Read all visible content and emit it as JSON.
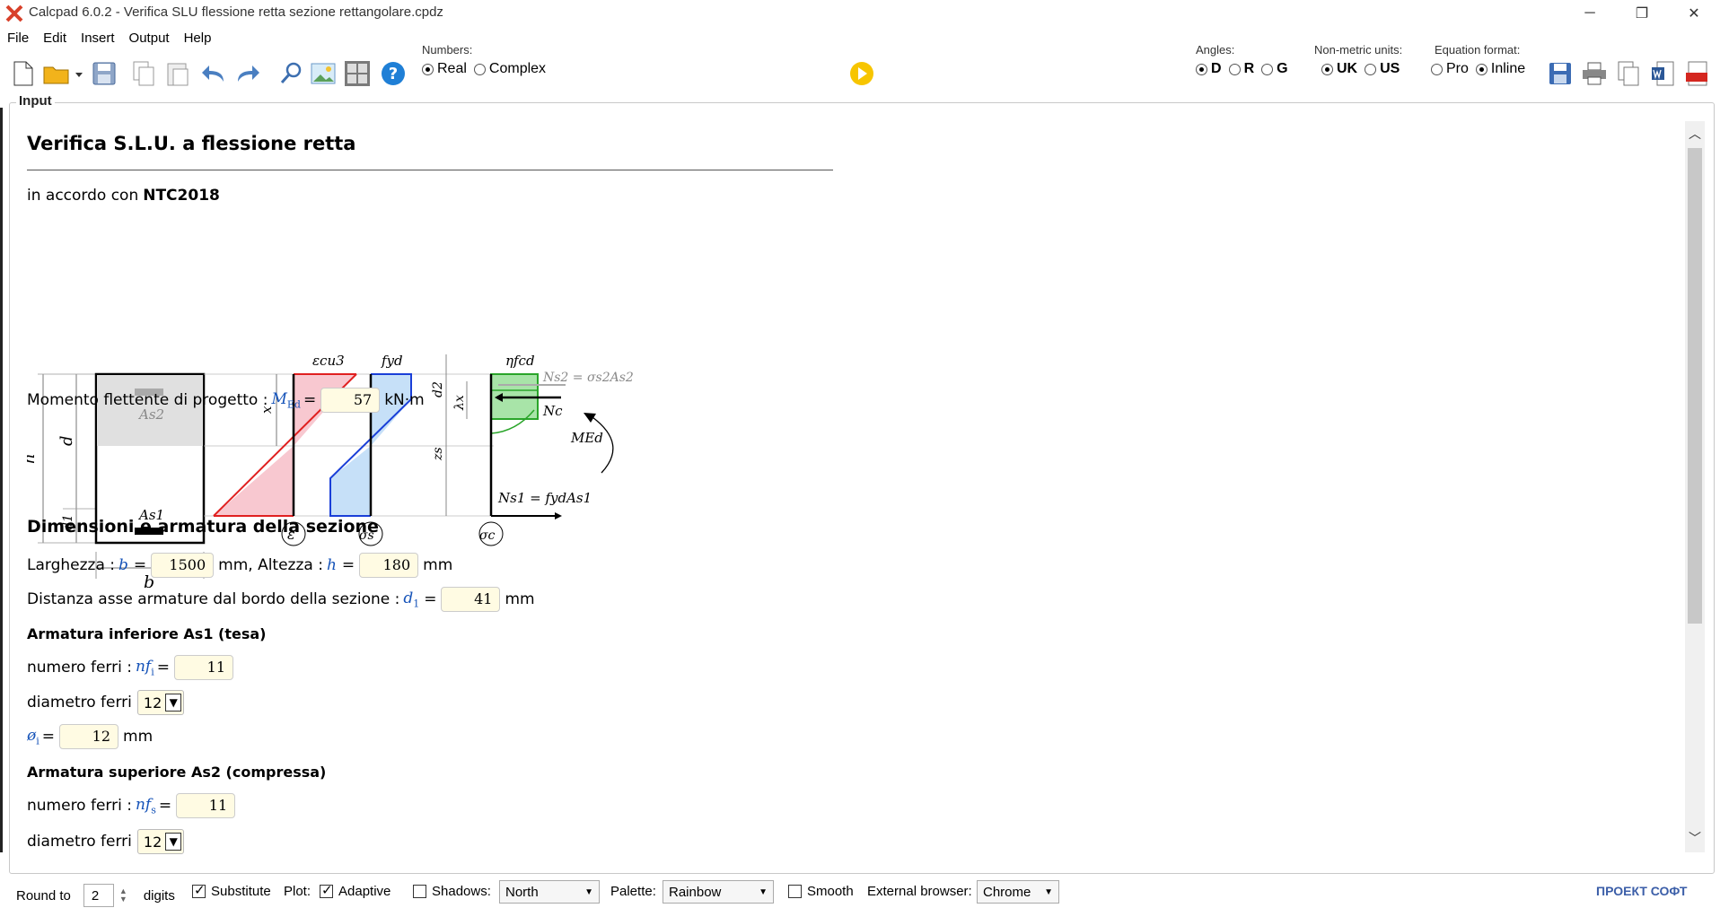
{
  "window": {
    "title": "Calcpad 6.0.2 - Verifica SLU flessione retta sezione rettangolare.cpdz",
    "controls": {
      "minimize": "─",
      "restore": "❐",
      "close": "✕"
    }
  },
  "menu": [
    "File",
    "Edit",
    "Insert",
    "Output",
    "Help"
  ],
  "toolbar": {
    "numbers_label": "Numbers:",
    "numbers_options": [
      "Real",
      "Complex"
    ],
    "numbers_selected": "Real",
    "angles_label": "Angles:",
    "angles_options": [
      "D",
      "R",
      "G"
    ],
    "angles_selected": "D",
    "units_label": "Non-metric units:",
    "units_options": [
      "UK",
      "US"
    ],
    "units_selected": "UK",
    "eqformat_label": "Equation format:",
    "eqformat_options": [
      "Pro",
      "Inline"
    ],
    "eqformat_selected": "Inline",
    "help_glyph": "?",
    "run_color": "#f7c500"
  },
  "panel": {
    "title": "Input"
  },
  "doc": {
    "title": "Verifica S.L.U. a flessione retta",
    "subtitle_prefix": "in accordo con ",
    "subtitle_bold": "NTC2018",
    "diagram_labels": {
      "eps_cu3": "εcu3",
      "fyd": "fyd",
      "eta_fcd": "ηfcd",
      "As2": "As2",
      "As1": "As1",
      "h": "h",
      "d": "d",
      "d1": "d1",
      "d2": "d2",
      "x": "x",
      "lambda_x": "λx",
      "zs": "zs",
      "b": "b",
      "Ns2": "Ns2 = σs2As2",
      "Nc": "Nc",
      "MEd": "MEd",
      "Ns1": "Ns1 = fydAs1",
      "circ_eps": "ε",
      "circ_sigma_s": "σs",
      "circ_sigma_c": "σc"
    },
    "moment": {
      "label": "Momento flettente di progetto : ",
      "var": "M",
      "sub": "Ed",
      "eq": "=",
      "value": "57",
      "unit": "kN·m"
    },
    "section_title": "Dimensioni e armatura della sezione",
    "dims": {
      "b_label": "Larghezza : ",
      "b_var": "b",
      "b_value": "1500",
      "b_unit": "mm, Altezza : ",
      "h_var": "h",
      "h_value": "180",
      "h_unit": "mm"
    },
    "d1": {
      "label": "Distanza asse armature dal bordo della sezione : ",
      "var": "d",
      "sub": "1",
      "value": "41",
      "unit": "mm"
    },
    "lower_title": "Armatura inferiore As1 (tesa)",
    "lower": {
      "count_label": "numero ferri : ",
      "count_var": "nf",
      "count_sub": "i",
      "count_value": "11",
      "diam_label": "diametro ferri",
      "diam_selected": "12",
      "phi_var": "ø",
      "phi_sub": "i",
      "phi_value": "12",
      "phi_unit": "mm"
    },
    "upper_title": "Armatura superiore As2 (compressa)",
    "upper": {
      "count_label": "numero ferri : ",
      "count_var": "nf",
      "count_sub": "s",
      "count_value": "11",
      "diam_label": "diametro ferri",
      "diam_selected": "12"
    }
  },
  "status": {
    "round_label": "Round to",
    "round_value": "2",
    "digits_label": "digits",
    "substitute_label": "Substitute",
    "substitute_checked": true,
    "plot_label": "Plot:",
    "adaptive_label": "Adaptive",
    "adaptive_checked": true,
    "shadows_label": "Shadows:",
    "shadows_checked": false,
    "shadows_value": "North",
    "palette_label": "Palette:",
    "palette_value": "Rainbow",
    "smooth_label": "Smooth",
    "smooth_checked": false,
    "browser_label": "External browser:",
    "browser_value": "Chrome",
    "brand": "ПРОЕКТ СОФТ"
  }
}
